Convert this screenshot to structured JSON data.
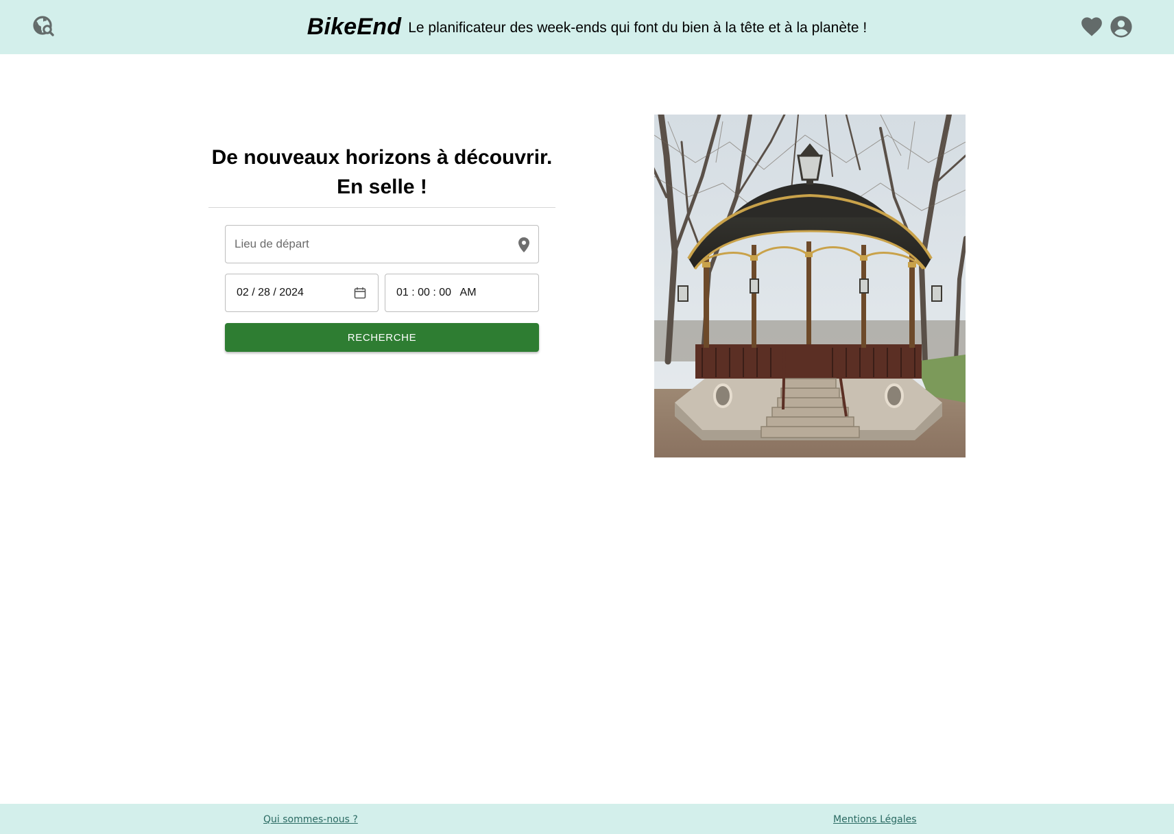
{
  "header": {
    "brand": "BikeEnd",
    "tagline": "Le planificateur des week-ends qui font du bien à la tête et à la planète !",
    "icons": [
      "globe-search-icon",
      "heart-icon",
      "account-circle-icon"
    ]
  },
  "hero": {
    "title_line1": "De nouveaux horizons à découvrir.",
    "title_line2": "En selle !"
  },
  "search": {
    "depart_placeholder": "Lieu de départ",
    "depart_value": "",
    "date_value": "02 / 28 / 2024",
    "time_value": "01 : 00 : 00   AM",
    "button_label": "RECHERCHE"
  },
  "footer": {
    "about_label": "Qui sommes-nous ?",
    "legal_label": "Mentions Légales"
  },
  "colors": {
    "header_bg": "#d3efeb",
    "button_bg": "#2e7d32",
    "icon_gray": "#636b6a",
    "footer_link": "#2a6a62"
  }
}
